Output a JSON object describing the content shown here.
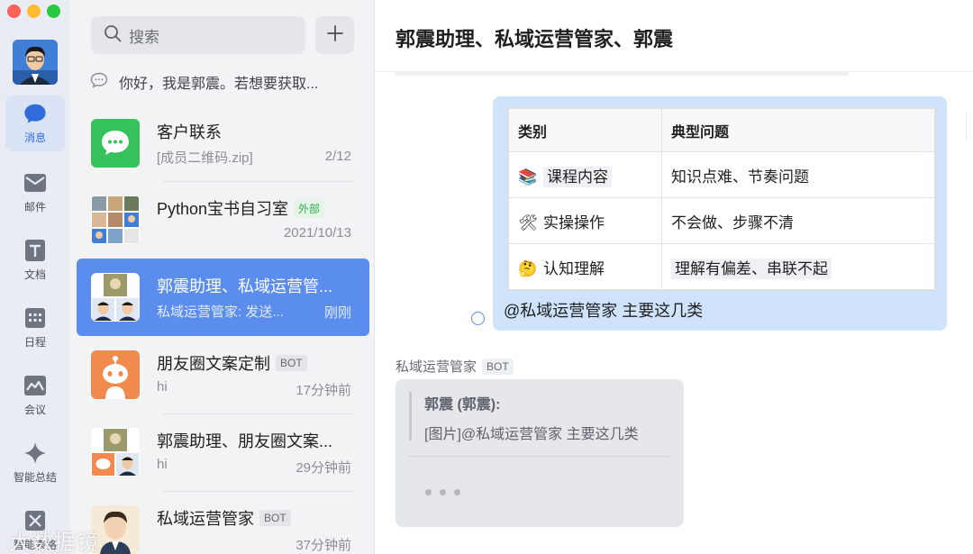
{
  "rail": {
    "items": [
      {
        "label": "消息",
        "icon": "message-icon",
        "active": true
      },
      {
        "label": "邮件",
        "icon": "mail-icon"
      },
      {
        "label": "文档",
        "icon": "doc-icon"
      },
      {
        "label": "日程",
        "icon": "calendar-icon"
      },
      {
        "label": "会议",
        "icon": "meeting-icon"
      },
      {
        "label": "智能总结",
        "icon": "sparkle-icon"
      },
      {
        "label": "智能表格",
        "icon": "smart-table-icon"
      }
    ]
  },
  "search": {
    "placeholder": "搜索"
  },
  "pinned": {
    "text": "你好，我是郭震。若想要获取..."
  },
  "conversations": [
    {
      "name": "客户联系",
      "sub": "[成员二维码.zip]",
      "time": "2/12"
    },
    {
      "name": "Python宝书自习室",
      "tag": "外部",
      "sub": "",
      "time": "2021/10/13"
    },
    {
      "name": "郭震助理、私域运营管...",
      "sub": "私域运营管家: 发送...",
      "time": "刚刚",
      "active": true
    },
    {
      "name": "朋友圈文案定制",
      "tag": "BOT",
      "sub": "hi",
      "time": "17分钟前"
    },
    {
      "name": "郭震助理、朋友圈文案...",
      "sub": "hi",
      "time": "29分钟前"
    },
    {
      "name": "私域运营管家",
      "tag": "BOT",
      "sub": "",
      "time": "37分钟前"
    }
  ],
  "chat": {
    "title": "郭震助理、私域运营管家、郭震",
    "image_table": {
      "headers": [
        "类别",
        "典型问题"
      ],
      "rows": [
        {
          "emoji": "📚",
          "category": "课程内容",
          "issue": "知识点难、节奏问题"
        },
        {
          "emoji": "🛠",
          "category": "实操操作",
          "issue": "不会做、步骤不清"
        },
        {
          "emoji": "🤔",
          "category": "认知理解",
          "issue": "理解有偏差、串联不起"
        }
      ]
    },
    "my_message_text": "@私域运营管家 主要这几类",
    "bot_sender": "私域运营管家",
    "bot_tag": "BOT",
    "quote_author": "郭震 (郭震):",
    "quote_body": "[图片]@私域运营管家 主要这几类"
  },
  "watermark": "大数据镜"
}
